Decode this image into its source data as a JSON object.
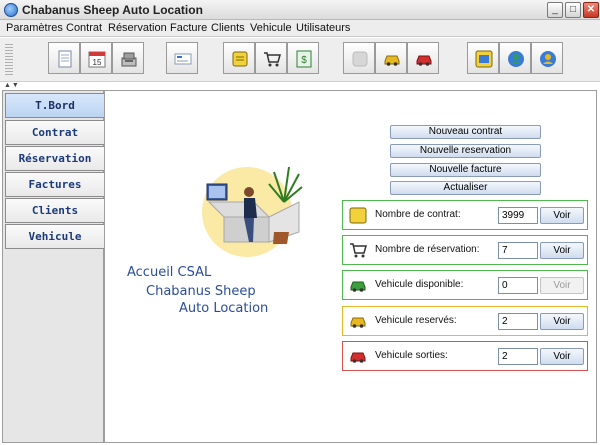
{
  "window": {
    "title": "Chabanus Sheep Auto Location",
    "minimize_label": "_",
    "maximize_label": "□",
    "close_label": "✕"
  },
  "menu": {
    "items": [
      "Paramètres",
      "Contrat",
      "Réservation",
      "Facture",
      "Clients",
      "Vehicule",
      "Utilisateurs"
    ]
  },
  "toolbar": {
    "buttons": [
      {
        "name": "document-icon",
        "color": "#ffffff"
      },
      {
        "name": "calendar-icon",
        "color": "#d23a3a",
        "text": "15"
      },
      {
        "name": "cash-register-icon",
        "color": "#8c8c8c"
      },
      {
        "name": "card-icon",
        "color": "#3a6fd6"
      },
      {
        "name": "note-icon",
        "color": "#f3d13a"
      },
      {
        "name": "cart-icon",
        "color": "#444444"
      },
      {
        "name": "invoice-icon",
        "color": "#2e7d32"
      },
      {
        "name": "car-disabled-icon",
        "color": "#c0c0c0"
      },
      {
        "name": "car-yellow-icon",
        "color": "#e8b820"
      },
      {
        "name": "car-red-icon",
        "color": "#d32f2f"
      },
      {
        "name": "client-card-icon",
        "color": "#3a7bd5"
      },
      {
        "name": "user-settings-icon",
        "color": "#2e9e5e"
      },
      {
        "name": "user-key-icon",
        "color": "#e8b820"
      }
    ]
  },
  "tabs": [
    "T.Bord",
    "Contrat",
    "Réservation",
    "Factures",
    "Clients",
    "Vehicule"
  ],
  "caption": {
    "line1": "Accueil CSAL",
    "line2": "Chabanus Sheep",
    "line3": "Auto Location"
  },
  "actions": [
    "Nouveau contrat",
    "Nouvelle reservation",
    "Nouvelle facture",
    "Actualiser"
  ],
  "stats": [
    {
      "label": "Nombre de contrat:",
      "value": "3999",
      "button": "Voir",
      "icon": "note-icon",
      "color": "#4fb84f",
      "enabled": true
    },
    {
      "label": "Nombre de réservation:",
      "value": "7",
      "button": "Voir",
      "icon": "cart-icon",
      "color": "#4fb84f",
      "enabled": true
    },
    {
      "label": "Vehicule disponible:",
      "value": "0",
      "button": "Voir",
      "icon": "car-green-icon",
      "color": "#4fb84f",
      "enabled": false
    },
    {
      "label": "Vehicule reservés:",
      "value": "2",
      "button": "Voir",
      "icon": "car-yellow-icon",
      "color": "#e6b82a",
      "enabled": true
    },
    {
      "label": "Vehicule sorties:",
      "value": "2",
      "button": "Voir",
      "icon": "car-red-icon",
      "color": "#d9534f",
      "enabled": true
    }
  ]
}
